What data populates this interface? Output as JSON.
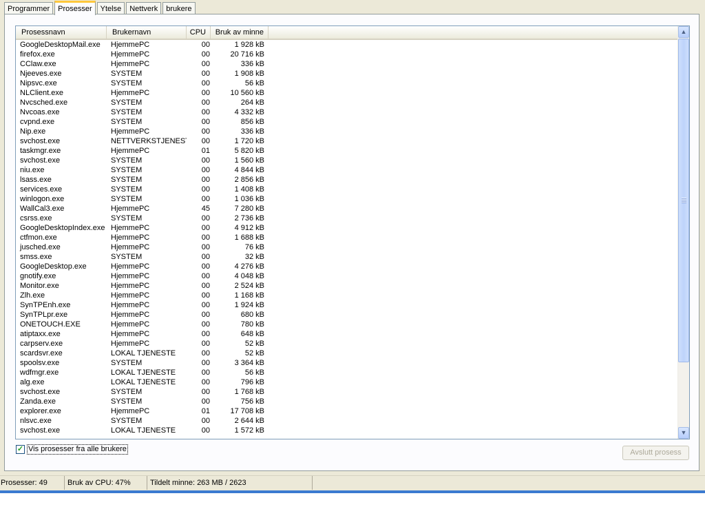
{
  "tabs": [
    {
      "label": "Programmer",
      "active": false
    },
    {
      "label": "Prosesser",
      "active": true
    },
    {
      "label": "Ytelse",
      "active": false
    },
    {
      "label": "Nettverk",
      "active": false
    },
    {
      "label": "brukere",
      "active": false
    }
  ],
  "table": {
    "columns": [
      "Prosessnavn",
      "Brukernavn",
      "CPU",
      "Bruk av minne"
    ],
    "rows": [
      [
        "GoogleDesktopMail.exe",
        "HjemmePC",
        "00",
        "1 928 kB"
      ],
      [
        "firefox.exe",
        "HjemmePC",
        "00",
        "20 716 kB"
      ],
      [
        "CClaw.exe",
        "HjemmePC",
        "00",
        "336 kB"
      ],
      [
        "Njeeves.exe",
        "SYSTEM",
        "00",
        "1 908 kB"
      ],
      [
        "Nipsvc.exe",
        "SYSTEM",
        "00",
        "56 kB"
      ],
      [
        "NLClient.exe",
        "HjemmePC",
        "00",
        "10 560 kB"
      ],
      [
        "Nvcsched.exe",
        "SYSTEM",
        "00",
        "264 kB"
      ],
      [
        "Nvcoas.exe",
        "SYSTEM",
        "00",
        "4 332 kB"
      ],
      [
        "cvpnd.exe",
        "SYSTEM",
        "00",
        "856 kB"
      ],
      [
        "Nip.exe",
        "HjemmePC",
        "00",
        "336 kB"
      ],
      [
        "svchost.exe",
        "NETTVERKSTJENESTE",
        "00",
        "1 720 kB"
      ],
      [
        "taskmgr.exe",
        "HjemmePC",
        "01",
        "5 820 kB"
      ],
      [
        "svchost.exe",
        "SYSTEM",
        "00",
        "1 560 kB"
      ],
      [
        "niu.exe",
        "SYSTEM",
        "00",
        "4 844 kB"
      ],
      [
        "lsass.exe",
        "SYSTEM",
        "00",
        "2 856 kB"
      ],
      [
        "services.exe",
        "SYSTEM",
        "00",
        "1 408 kB"
      ],
      [
        "winlogon.exe",
        "SYSTEM",
        "00",
        "1 036 kB"
      ],
      [
        "WallCal3.exe",
        "HjemmePC",
        "45",
        "7 280 kB"
      ],
      [
        "csrss.exe",
        "SYSTEM",
        "00",
        "2 736 kB"
      ],
      [
        "GoogleDesktopIndex.exe",
        "HjemmePC",
        "00",
        "4 912 kB"
      ],
      [
        "ctfmon.exe",
        "HjemmePC",
        "00",
        "1 688 kB"
      ],
      [
        "jusched.exe",
        "HjemmePC",
        "00",
        "76 kB"
      ],
      [
        "smss.exe",
        "SYSTEM",
        "00",
        "32 kB"
      ],
      [
        "GoogleDesktop.exe",
        "HjemmePC",
        "00",
        "4 276 kB"
      ],
      [
        "gnotify.exe",
        "HjemmePC",
        "00",
        "4 048 kB"
      ],
      [
        "Monitor.exe",
        "HjemmePC",
        "00",
        "2 524 kB"
      ],
      [
        "Zlh.exe",
        "HjemmePC",
        "00",
        "1 168 kB"
      ],
      [
        "SynTPEnh.exe",
        "HjemmePC",
        "00",
        "1 924 kB"
      ],
      [
        "SynTPLpr.exe",
        "HjemmePC",
        "00",
        "680 kB"
      ],
      [
        "ONETOUCH.EXE",
        "HjemmePC",
        "00",
        "780 kB"
      ],
      [
        "atiptaxx.exe",
        "HjemmePC",
        "00",
        "648 kB"
      ],
      [
        "carpserv.exe",
        "HjemmePC",
        "00",
        "52 kB"
      ],
      [
        "scardsvr.exe",
        "LOKAL TJENESTE",
        "00",
        "52 kB"
      ],
      [
        "spoolsv.exe",
        "SYSTEM",
        "00",
        "3 364 kB"
      ],
      [
        "wdfmgr.exe",
        "LOKAL TJENESTE",
        "00",
        "56 kB"
      ],
      [
        "alg.exe",
        "LOKAL TJENESTE",
        "00",
        "796 kB"
      ],
      [
        "svchost.exe",
        "SYSTEM",
        "00",
        "1 768 kB"
      ],
      [
        "Zanda.exe",
        "SYSTEM",
        "00",
        "756 kB"
      ],
      [
        "explorer.exe",
        "HjemmePC",
        "01",
        "17 708 kB"
      ],
      [
        "nlsvc.exe",
        "SYSTEM",
        "00",
        "2 644 kB"
      ],
      [
        "svchost.exe",
        "LOKAL TJENESTE",
        "00",
        "1 572 kB"
      ]
    ]
  },
  "checkbox": {
    "label": "Vis prosesser fra alle brukere",
    "checked": true
  },
  "end_process_label": "Avslutt prosess",
  "status": {
    "processes": "Prosesser: 49",
    "cpu": "Bruk av CPU: 47%",
    "memory": "Tildelt minne: 263 MB / 2623"
  },
  "icons": {
    "check": "✓",
    "scroll_up": "▲",
    "scroll_down": "▼"
  },
  "colors": {
    "tab_accent": "#ffc83c",
    "scroll": "#bed3fb",
    "selection_line": "#3b7ad0"
  }
}
